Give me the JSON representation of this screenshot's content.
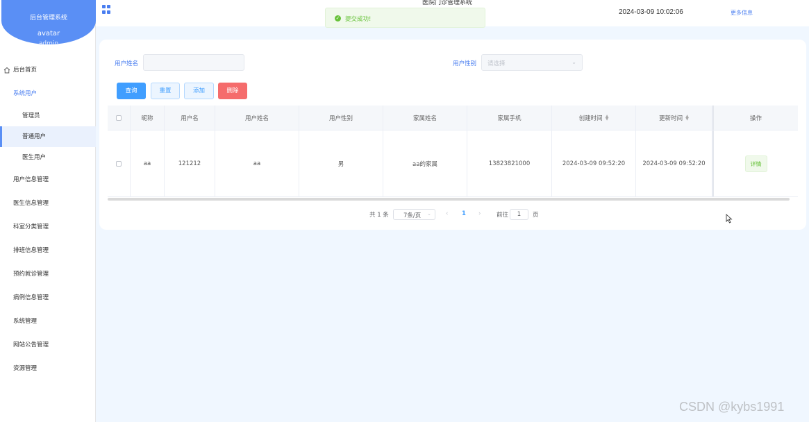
{
  "brand": {
    "title": "后台管理系统",
    "avatar_alt": "avatar",
    "username": "admin"
  },
  "header": {
    "title": "医院门诊管理系统",
    "datetime": "2024-03-09 10:02:06",
    "more_info": "更多信息"
  },
  "toast": {
    "message": "提交成功!"
  },
  "sidebar": {
    "home": "后台首页",
    "group_label": "系统用户",
    "sub_items": [
      "管理员",
      "普通用户",
      "医生用户"
    ],
    "items": [
      "用户信息管理",
      "医生信息管理",
      "科室分类管理",
      "排班信息管理",
      "预约就诊管理",
      "病例信息管理",
      "系统管理",
      "网站公告管理",
      "资源管理"
    ]
  },
  "search": {
    "name_label": "用户姓名",
    "gender_label": "用户性别",
    "gender_placeholder": "请选择"
  },
  "buttons": {
    "query": "查询",
    "reset": "重置",
    "add": "添加",
    "delete": "删除",
    "detail": "详情"
  },
  "table": {
    "columns": [
      "昵称",
      "用户名",
      "用户姓名",
      "用户性别",
      "家属姓名",
      "家属手机",
      "创建时间",
      "更新时间",
      "操作"
    ],
    "rows": [
      {
        "nickname": "aa",
        "username": "121212",
        "realname": "aa",
        "gender": "男",
        "family_name": "aa的家属",
        "family_phone": "13823821000",
        "created": "2024-03-09 09:52:20",
        "updated": "2024-03-09 09:52:20"
      }
    ]
  },
  "pagination": {
    "total": "共 1 条",
    "page_size": "7条/页",
    "current": "1",
    "goto_label": "前往",
    "goto_value": "1",
    "page_suffix": "页",
    "prev": "‹",
    "next": "›"
  },
  "watermark": "CSDN @kybs1991",
  "colors": {
    "primary": "#409eff",
    "brand": "#5a8ff5",
    "danger": "#f56c6c",
    "success": "#67c23a"
  }
}
